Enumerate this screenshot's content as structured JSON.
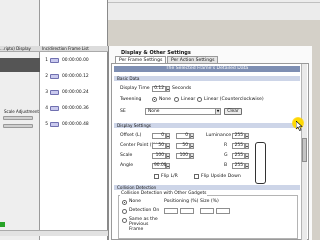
{
  "left_panel": {
    "header": "…ripto) Display",
    "caption": "Scale Adjustment"
  },
  "frame_list": {
    "header": "Inc/direction Frame List",
    "rows": [
      {
        "num": "1",
        "time": "00:00:00.00"
      },
      {
        "num": "2",
        "time": "00:00:00.12"
      },
      {
        "num": "3",
        "time": "00:00:00.24"
      },
      {
        "num": "4",
        "time": "00:00:00.36"
      },
      {
        "num": "5",
        "time": "00:00:00.48"
      }
    ]
  },
  "dialog": {
    "title": "Display & Other Settings",
    "tabs": [
      "Per Frame Settings",
      "Per Action Settings"
    ],
    "banner": "The Selected Frame's Detailed Data",
    "basic_data": {
      "section": "Basic Data",
      "display_time_label": "Display Time",
      "display_time_value": "0.12",
      "display_time_unit": "Seconds",
      "tweening_label": "Tweening",
      "tweening_options": [
        "None",
        "Linear",
        "Linear (Counterclockwise)"
      ],
      "tweening_selected": "None",
      "se_label": "SE",
      "se_value": "None",
      "clear_button": "Clear"
    },
    "display_settings": {
      "section": "Display Settings",
      "offset_label": "Offset (L)",
      "offset_x": "0",
      "offset_y": "0",
      "center_label": "Center Point (%)",
      "center_x": "50",
      "center_y": "50",
      "scale_label": "Scale",
      "scale_x": "100",
      "scale_y": "100",
      "angle_label": "Angle",
      "angle_value": "90.00",
      "luminance_label": "Luminance",
      "luminance_values": [
        "255",
        "255",
        "255",
        "255"
      ],
      "channel_labels": [
        "R",
        "G",
        "B"
      ],
      "flip_lr": "Flip L/R",
      "flip_ud": "Flip Upside Down"
    },
    "collision": {
      "section": "Collision Detection",
      "group_title": "Collision Detection with Other Gadgets",
      "options": [
        "None",
        "Detection On",
        "Same as the Previous Frame"
      ],
      "selected": "None",
      "positioning_label": "Positioning (%)",
      "size_label": "Size (%)"
    }
  },
  "colors": {
    "banner": "#7e8fb3",
    "section_bar": "#cdd5e8",
    "cursor_highlight": "#ffe900"
  },
  "icons": [
    "film-frame-icon",
    "mouse-cursor-icon",
    "spin-button-icon",
    "dropdown-arrow-icon"
  ]
}
